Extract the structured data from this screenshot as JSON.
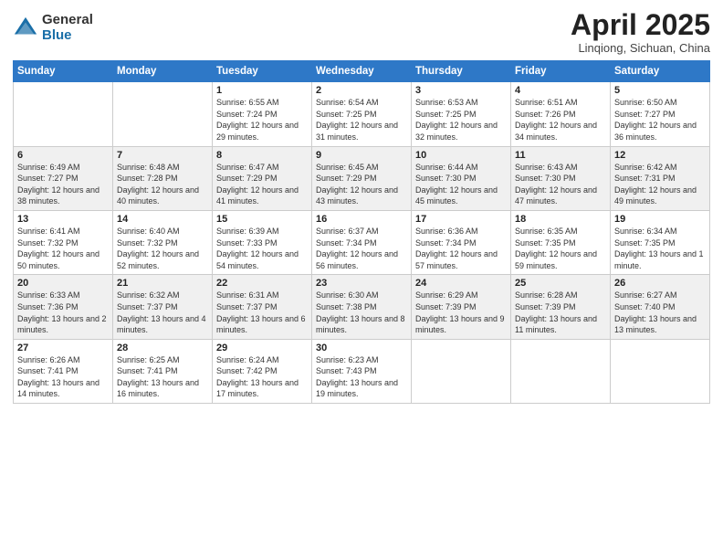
{
  "header": {
    "logo_general": "General",
    "logo_blue": "Blue",
    "title": "April 2025",
    "subtitle": "Linqiong, Sichuan, China"
  },
  "weekdays": [
    "Sunday",
    "Monday",
    "Tuesday",
    "Wednesday",
    "Thursday",
    "Friday",
    "Saturday"
  ],
  "weeks": [
    [
      {
        "day": "",
        "info": ""
      },
      {
        "day": "",
        "info": ""
      },
      {
        "day": "1",
        "info": "Sunrise: 6:55 AM\nSunset: 7:24 PM\nDaylight: 12 hours and 29 minutes."
      },
      {
        "day": "2",
        "info": "Sunrise: 6:54 AM\nSunset: 7:25 PM\nDaylight: 12 hours and 31 minutes."
      },
      {
        "day": "3",
        "info": "Sunrise: 6:53 AM\nSunset: 7:25 PM\nDaylight: 12 hours and 32 minutes."
      },
      {
        "day": "4",
        "info": "Sunrise: 6:51 AM\nSunset: 7:26 PM\nDaylight: 12 hours and 34 minutes."
      },
      {
        "day": "5",
        "info": "Sunrise: 6:50 AM\nSunset: 7:27 PM\nDaylight: 12 hours and 36 minutes."
      }
    ],
    [
      {
        "day": "6",
        "info": "Sunrise: 6:49 AM\nSunset: 7:27 PM\nDaylight: 12 hours and 38 minutes."
      },
      {
        "day": "7",
        "info": "Sunrise: 6:48 AM\nSunset: 7:28 PM\nDaylight: 12 hours and 40 minutes."
      },
      {
        "day": "8",
        "info": "Sunrise: 6:47 AM\nSunset: 7:29 PM\nDaylight: 12 hours and 41 minutes."
      },
      {
        "day": "9",
        "info": "Sunrise: 6:45 AM\nSunset: 7:29 PM\nDaylight: 12 hours and 43 minutes."
      },
      {
        "day": "10",
        "info": "Sunrise: 6:44 AM\nSunset: 7:30 PM\nDaylight: 12 hours and 45 minutes."
      },
      {
        "day": "11",
        "info": "Sunrise: 6:43 AM\nSunset: 7:30 PM\nDaylight: 12 hours and 47 minutes."
      },
      {
        "day": "12",
        "info": "Sunrise: 6:42 AM\nSunset: 7:31 PM\nDaylight: 12 hours and 49 minutes."
      }
    ],
    [
      {
        "day": "13",
        "info": "Sunrise: 6:41 AM\nSunset: 7:32 PM\nDaylight: 12 hours and 50 minutes."
      },
      {
        "day": "14",
        "info": "Sunrise: 6:40 AM\nSunset: 7:32 PM\nDaylight: 12 hours and 52 minutes."
      },
      {
        "day": "15",
        "info": "Sunrise: 6:39 AM\nSunset: 7:33 PM\nDaylight: 12 hours and 54 minutes."
      },
      {
        "day": "16",
        "info": "Sunrise: 6:37 AM\nSunset: 7:34 PM\nDaylight: 12 hours and 56 minutes."
      },
      {
        "day": "17",
        "info": "Sunrise: 6:36 AM\nSunset: 7:34 PM\nDaylight: 12 hours and 57 minutes."
      },
      {
        "day": "18",
        "info": "Sunrise: 6:35 AM\nSunset: 7:35 PM\nDaylight: 12 hours and 59 minutes."
      },
      {
        "day": "19",
        "info": "Sunrise: 6:34 AM\nSunset: 7:35 PM\nDaylight: 13 hours and 1 minute."
      }
    ],
    [
      {
        "day": "20",
        "info": "Sunrise: 6:33 AM\nSunset: 7:36 PM\nDaylight: 13 hours and 2 minutes."
      },
      {
        "day": "21",
        "info": "Sunrise: 6:32 AM\nSunset: 7:37 PM\nDaylight: 13 hours and 4 minutes."
      },
      {
        "day": "22",
        "info": "Sunrise: 6:31 AM\nSunset: 7:37 PM\nDaylight: 13 hours and 6 minutes."
      },
      {
        "day": "23",
        "info": "Sunrise: 6:30 AM\nSunset: 7:38 PM\nDaylight: 13 hours and 8 minutes."
      },
      {
        "day": "24",
        "info": "Sunrise: 6:29 AM\nSunset: 7:39 PM\nDaylight: 13 hours and 9 minutes."
      },
      {
        "day": "25",
        "info": "Sunrise: 6:28 AM\nSunset: 7:39 PM\nDaylight: 13 hours and 11 minutes."
      },
      {
        "day": "26",
        "info": "Sunrise: 6:27 AM\nSunset: 7:40 PM\nDaylight: 13 hours and 13 minutes."
      }
    ],
    [
      {
        "day": "27",
        "info": "Sunrise: 6:26 AM\nSunset: 7:41 PM\nDaylight: 13 hours and 14 minutes."
      },
      {
        "day": "28",
        "info": "Sunrise: 6:25 AM\nSunset: 7:41 PM\nDaylight: 13 hours and 16 minutes."
      },
      {
        "day": "29",
        "info": "Sunrise: 6:24 AM\nSunset: 7:42 PM\nDaylight: 13 hours and 17 minutes."
      },
      {
        "day": "30",
        "info": "Sunrise: 6:23 AM\nSunset: 7:43 PM\nDaylight: 13 hours and 19 minutes."
      },
      {
        "day": "",
        "info": ""
      },
      {
        "day": "",
        "info": ""
      },
      {
        "day": "",
        "info": ""
      }
    ]
  ]
}
